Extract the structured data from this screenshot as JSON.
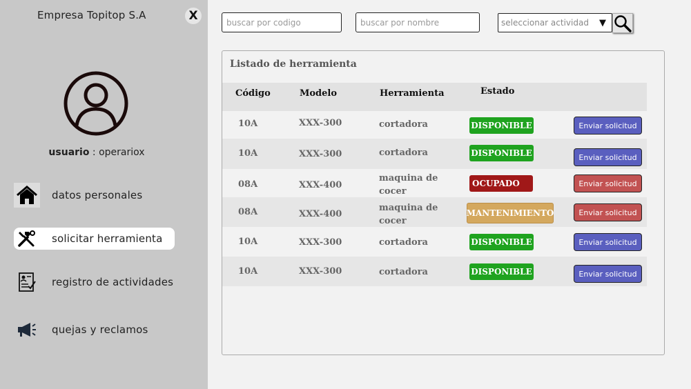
{
  "sidebar": {
    "company": "Empresa Topitop S.A",
    "close_label": "X",
    "user_label": "usuario",
    "user_sep": " : ",
    "user_name": "operariox",
    "items": [
      {
        "label": "datos personales",
        "icon": "home-icon"
      },
      {
        "label": "solicitar herramienta",
        "icon": "tools-icon",
        "active": true
      },
      {
        "label": "registro de actividades",
        "icon": "clipboard-icon"
      },
      {
        "label": "quejas y reclamos",
        "icon": "megaphone-icon"
      }
    ]
  },
  "search": {
    "code_placeholder": "buscar por codigo",
    "name_placeholder": "buscar por nombre",
    "activity_select": "seleccionar actividad"
  },
  "panel": {
    "title": "Listado de herramienta",
    "headers": {
      "code": "Código",
      "model": "Modelo",
      "tool": "Herramienta",
      "status": "Estado"
    },
    "rows": [
      {
        "code": "10A",
        "model": "XXX-300",
        "tool": "cortadora",
        "status": "DISPONIBLE",
        "status_color": "#1fa31f",
        "action": "Enviar solicitud",
        "action_color": "#5a5fbf"
      },
      {
        "code": "10A",
        "model": "XXX-300",
        "tool": "cortadora",
        "status": "DISPONIBLE",
        "status_color": "#1fa31f",
        "action": "Enviar solicitud",
        "action_color": "#5a5fbf"
      },
      {
        "code": "08A",
        "model": "XXX-400",
        "tool": "maquina de cocer",
        "status": "OCUPADO",
        "status_color": "#a01818",
        "action": "Enviar solicitud",
        "action_color": "#c25252"
      },
      {
        "code": "08A",
        "model": "XXX-400",
        "tool": "maquina de cocer",
        "status": "MANTENIMIENTO",
        "status_color": "#d4a85e",
        "action": "Enviar solicitud",
        "action_color": "#c25252"
      },
      {
        "code": "10A",
        "model": "XXX-300",
        "tool": "cortadora",
        "status": "DISPONIBLE",
        "status_color": "#1fa31f",
        "action": "Enviar solicitud",
        "action_color": "#5a5fbf"
      },
      {
        "code": "10A",
        "model": "XXX-300",
        "tool": "cortadora",
        "status": "DISPONIBLE",
        "status_color": "#1fa31f",
        "action": "Enviar solicitud",
        "action_color": "#5a5fbf"
      }
    ]
  },
  "colors": {
    "sidebar_bg": "#c8c8c8",
    "available": "#1fa31f",
    "busy": "#a01818",
    "maintenance": "#d4a85e",
    "send_blue": "#5a5fbf",
    "send_red": "#c25252"
  }
}
